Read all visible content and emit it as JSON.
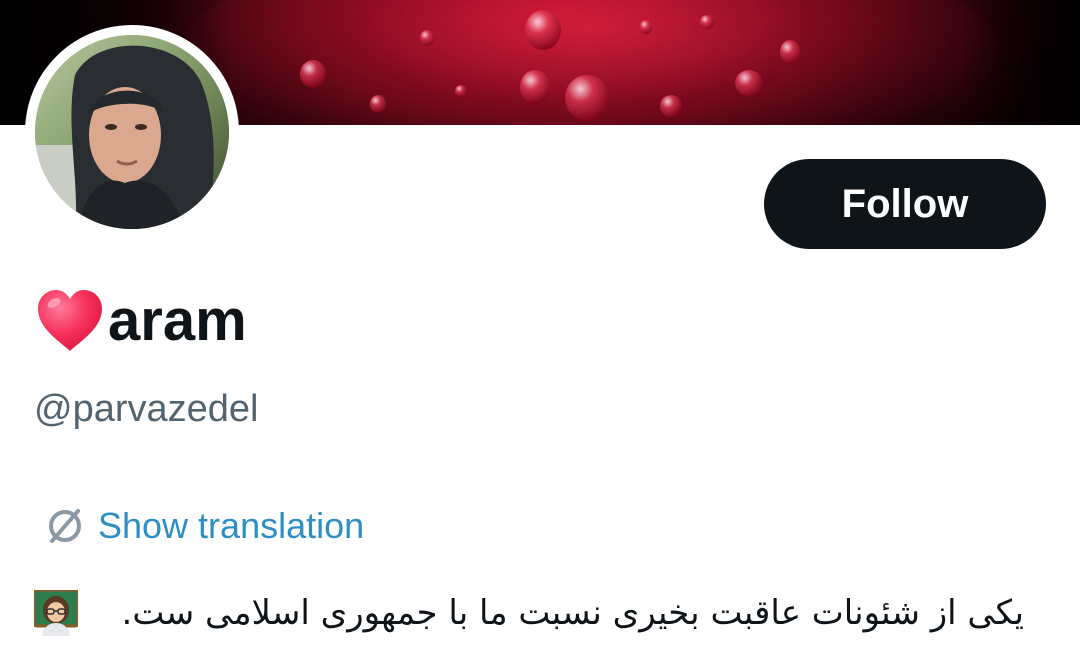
{
  "profile": {
    "display_name": "aram",
    "name_emoji": "red-heart-icon",
    "handle": "@parvazedel",
    "follow_label": "Follow",
    "translation_label": "Show translation",
    "bio_text": "یکی از شئونات عاقبت بخیری نسبت ما با جمهوری اسلامی ست.",
    "bio_emoji": "woman-teacher-icon"
  },
  "colors": {
    "follow_button_bg": "#0f1419",
    "follow_button_text": "#ffffff",
    "handle_text": "#536471",
    "link_text": "#2f8fc4",
    "banner_accent": "#c0102e"
  }
}
